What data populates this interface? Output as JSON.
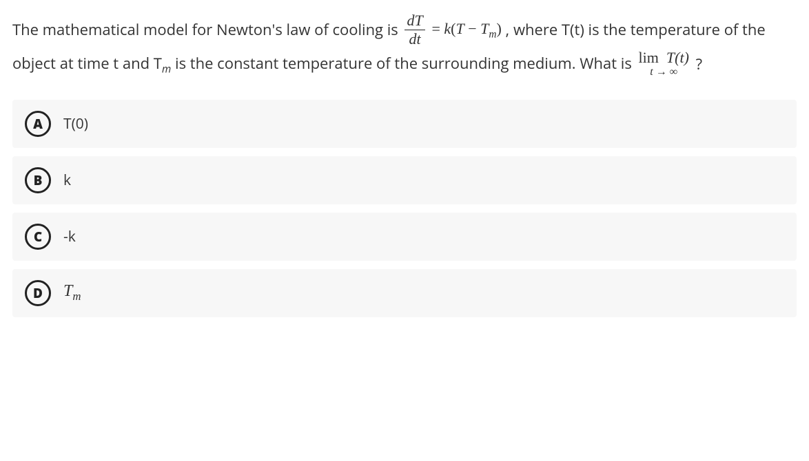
{
  "question": {
    "part1": "The mathematical model for Newton's law of cooling is ",
    "eq_frac_num": "dT",
    "eq_frac_den": "dt",
    "eq_eq": " = ",
    "eq_rhs_k": "k",
    "eq_rhs_paren_open": "(",
    "eq_rhs_T": "T",
    "eq_rhs_minus": " − ",
    "eq_rhs_Tm_T": "T",
    "eq_rhs_Tm_sub": "m",
    "eq_rhs_paren_close": ")",
    "part2": " , where T(t) is the temperature of the object at time t and T",
    "part2_sub": "m",
    "part3": " is the constant temperature of the surrounding medium. What is ",
    "lim_top": "lim",
    "lim_bot": "t → ∞",
    "lim_fn": "T(t)",
    "qmark": " ?"
  },
  "answers": [
    {
      "letter": "A",
      "text": "T(0)",
      "is_math": false
    },
    {
      "letter": "B",
      "text": "k",
      "is_math": false
    },
    {
      "letter": "C",
      "text": "-k",
      "is_math": false
    },
    {
      "letter": "D",
      "text_T": "T",
      "text_sub": "m",
      "is_math": true
    }
  ]
}
